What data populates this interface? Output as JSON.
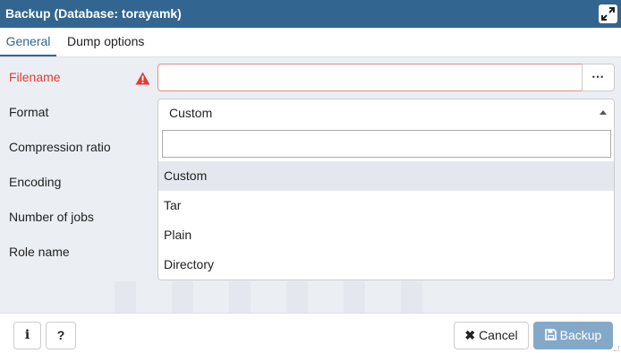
{
  "window": {
    "title": "Backup (Database: torayamk)",
    "maximize_icon": "maximize-icon"
  },
  "tabs": [
    {
      "label": "General",
      "active": true
    },
    {
      "label": "Dump options",
      "active": false
    }
  ],
  "form": {
    "filename_label": "Filename",
    "filename_value": "",
    "browse_label": "⋯",
    "format_label": "Format",
    "format_value": "Custom",
    "compression_label": "Compression ratio",
    "encoding_label": "Encoding",
    "jobs_label": "Number of jobs",
    "role_label": "Role name"
  },
  "dropdown": {
    "search_value": "",
    "options": [
      "Custom",
      "Tar",
      "Plain",
      "Directory"
    ],
    "selected": "Custom"
  },
  "footer": {
    "info_label": "i",
    "help_label": "?",
    "cancel_label": "Cancel",
    "cancel_icon": "✖",
    "backup_label": "Backup"
  },
  "colors": {
    "titlebar": "#326690",
    "error": "#e53935",
    "primary_disabled": "#84a9c8"
  }
}
